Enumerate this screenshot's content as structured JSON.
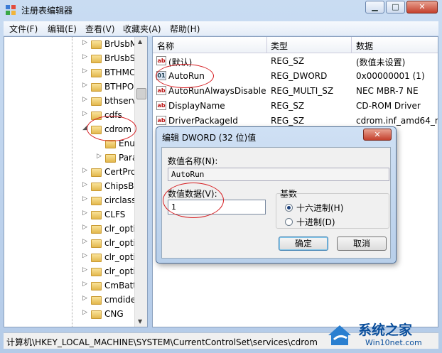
{
  "window": {
    "title": "注册表编辑器",
    "min_label": "▁",
    "max_label": "□",
    "close_label": "✕"
  },
  "menu": [
    "文件(F)",
    "编辑(E)",
    "查看(V)",
    "收藏夹(A)",
    "帮助(H)"
  ],
  "tree": {
    "items": [
      {
        "label": "BrUsbM",
        "exp": "▷"
      },
      {
        "label": "BrUsbS",
        "exp": "▷"
      },
      {
        "label": "BTHMC",
        "exp": "▷"
      },
      {
        "label": "BTHPO",
        "exp": "▷"
      },
      {
        "label": "bthserv",
        "exp": "▷"
      },
      {
        "label": "cdfs",
        "exp": "▷"
      },
      {
        "label": "cdrom",
        "exp": "◢"
      },
      {
        "label": "Enu",
        "exp": ""
      },
      {
        "label": "Para",
        "exp": "▷"
      },
      {
        "label": "CertPro",
        "exp": "▷"
      },
      {
        "label": "ChipsBa",
        "exp": "▷"
      },
      {
        "label": "circlass",
        "exp": "▷"
      },
      {
        "label": "CLFS",
        "exp": "▷"
      },
      {
        "label": "clr_opti",
        "exp": "▷"
      },
      {
        "label": "clr_opti",
        "exp": "▷"
      },
      {
        "label": "clr_opti",
        "exp": "▷"
      },
      {
        "label": "clr_opti",
        "exp": "▷"
      },
      {
        "label": "CmBatt",
        "exp": "▷"
      },
      {
        "label": "cmdide",
        "exp": "▷"
      },
      {
        "label": "CNG",
        "exp": "▷"
      }
    ]
  },
  "list": {
    "headers": {
      "name": "名称",
      "type": "类型",
      "data": "数据"
    },
    "rows": [
      {
        "icon": "ab",
        "name": "(默认)",
        "type": "REG_SZ",
        "data": "(数值未设置)"
      },
      {
        "icon": "bin",
        "name": "AutoRun",
        "type": "REG_DWORD",
        "data": "0x00000001 (1)"
      },
      {
        "icon": "ab",
        "name": "AutoRunAlwaysDisable",
        "type": "REG_MULTI_SZ",
        "data": "NEC    MBR-7    NE"
      },
      {
        "icon": "ab",
        "name": "DisplayName",
        "type": "REG_SZ",
        "data": "CD-ROM Driver"
      },
      {
        "icon": "ab",
        "name": "DriverPackageId",
        "type": "REG_SZ",
        "data": "cdrom.inf_amd64_n"
      },
      {
        "icon": "ab",
        "name": "",
        "type": "",
        "data": "1 (1)"
      },
      {
        "icon": "ab",
        "name": "",
        "type": "",
        "data": "OM Class"
      },
      {
        "icon": "ab",
        "name": "",
        "type": "",
        "data": "DRIVERS\\"
      },
      {
        "icon": "ab",
        "name": "",
        "type": "",
        "data": "1 (1)"
      },
      {
        "icon": "ab",
        "name": "",
        "type": "",
        "data": "3 (3)"
      },
      {
        "icon": "ab",
        "name": "",
        "type": "",
        "data": "1 (1)"
      }
    ]
  },
  "dialog": {
    "title": "编辑 DWORD (32 位)值",
    "close": "✕",
    "name_label": "数值名称(N):",
    "name_value": "AutoRun",
    "data_label": "数值数据(V):",
    "data_value": "1",
    "base_label": "基数",
    "hex_label": "十六进制(H)",
    "dec_label": "十进制(D)",
    "selected_base": "hex",
    "ok": "确定",
    "cancel": "取消"
  },
  "status": {
    "path": "计算机\\HKEY_LOCAL_MACHINE\\SYSTEM\\CurrentControlSet\\services\\cdrom"
  },
  "watermark": {
    "title": "系统之家",
    "url": "Win10net.com"
  }
}
